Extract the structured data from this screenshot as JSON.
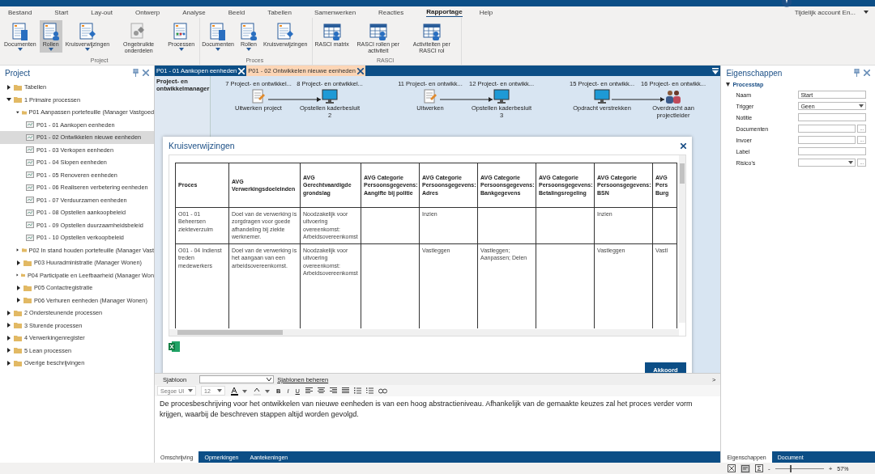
{
  "account": {
    "label": "Tijdelijk account En..."
  },
  "menu": [
    {
      "label": "Bestand",
      "selected": false
    },
    {
      "label": "Start",
      "selected": false
    },
    {
      "label": "Lay-out",
      "selected": false
    },
    {
      "label": "Ontwerp",
      "selected": false
    },
    {
      "label": "Analyse",
      "selected": false
    },
    {
      "label": "Beeld",
      "selected": false
    },
    {
      "label": "Tabellen",
      "selected": false
    },
    {
      "label": "Samenwerken",
      "selected": false
    },
    {
      "label": "Reacties",
      "selected": false
    },
    {
      "label": "Rapportage",
      "selected": true
    },
    {
      "label": "Help",
      "selected": false
    }
  ],
  "ribbon": [
    {
      "label": "Project",
      "buttons": [
        {
          "label": "Documenten",
          "dropdown": true,
          "selected": false
        },
        {
          "label": "Rollen",
          "dropdown": true,
          "selected": true
        },
        {
          "label": "Kruisverwijzingen",
          "dropdown": true,
          "selected": false
        },
        {
          "label": "Ongebruikte onderdelen",
          "dropdown": false,
          "selected": false
        },
        {
          "label": "Processen",
          "dropdown": true,
          "selected": false
        }
      ]
    },
    {
      "label": "Proces",
      "buttons": [
        {
          "label": "Documenten",
          "dropdown": true,
          "selected": false
        },
        {
          "label": "Rollen",
          "dropdown": true,
          "selected": false
        },
        {
          "label": "Kruisverwijzingen",
          "dropdown": false,
          "selected": false
        }
      ]
    },
    {
      "label": "RASCI",
      "buttons": [
        {
          "label": "RASCI matrix",
          "dropdown": false,
          "selected": false
        },
        {
          "label": "RASCI rollen per activiteit",
          "dropdown": false,
          "selected": false
        },
        {
          "label": "Activiteiten per RASCI rol",
          "dropdown": false,
          "selected": false
        }
      ]
    }
  ],
  "project_panel": {
    "title": "Project",
    "tree": [
      {
        "label": "Tabellen",
        "kind": "folder",
        "expanded": false,
        "selected": false
      },
      {
        "label": "1 Primaire processen",
        "kind": "folder",
        "expanded": true,
        "selected": false,
        "children": [
          {
            "label": "P01 Aanpassen portefeuille (Manager Vastgoed",
            "kind": "folder",
            "expanded": true,
            "selected": false,
            "children": [
              {
                "label": "P01 - 01 Aankopen eenheden",
                "kind": "process",
                "selected": false
              },
              {
                "label": "P01 - 02 Ontwikkelen nieuwe eenheden",
                "kind": "process",
                "selected": true
              },
              {
                "label": "P01 - 03 Verkopen eenheden",
                "kind": "process",
                "selected": false
              },
              {
                "label": "P01 - 04 Slopen eenheden",
                "kind": "process",
                "selected": false
              },
              {
                "label": "P01 - 05 Renoveren eenheden",
                "kind": "process",
                "selected": false
              },
              {
                "label": "P01 - 06 Realiseren verbetering eenheden",
                "kind": "process",
                "selected": false
              },
              {
                "label": "P01 - 07 Verduurzamen eenheden",
                "kind": "process",
                "selected": false
              },
              {
                "label": "P01 - 08 Opstellen aankoopbeleid",
                "kind": "process",
                "selected": false
              },
              {
                "label": "P01 - 09 Opstellen duurzaamheidsbeleid",
                "kind": "process",
                "selected": false
              },
              {
                "label": "P01 - 10 Opstellen verkoopbeleid",
                "kind": "process",
                "selected": false
              }
            ]
          },
          {
            "label": "P02 In stand houden portefeuille (Manager Vast",
            "kind": "folder",
            "expanded": false,
            "selected": false
          },
          {
            "label": "P03 Huuradministratie (Manager Wonen)",
            "kind": "folder",
            "expanded": false,
            "selected": false
          },
          {
            "label": "P04 Participatie en Leefbaarheid (Manager Won",
            "kind": "folder",
            "expanded": false,
            "selected": false
          },
          {
            "label": "P05 Contactregistratie",
            "kind": "folder",
            "expanded": false,
            "selected": false
          },
          {
            "label": "P06 Verhuren eenheden (Manager Wonen)",
            "kind": "folder",
            "expanded": false,
            "selected": false
          }
        ]
      },
      {
        "label": "2 Ondersteunende processen",
        "kind": "folder",
        "expanded": false,
        "selected": false
      },
      {
        "label": "3 Sturende processen",
        "kind": "folder",
        "expanded": false,
        "selected": false
      },
      {
        "label": "4 Verwerkingenregister",
        "kind": "folder",
        "expanded": false,
        "selected": false
      },
      {
        "label": "5 Lean processen",
        "kind": "folder",
        "expanded": false,
        "selected": false
      },
      {
        "label": "Overige beschrijvingen",
        "kind": "folder",
        "expanded": false,
        "selected": false
      }
    ]
  },
  "editor_tabs": [
    {
      "label": "P01 - 01 Aankopen eenheden",
      "selected": false
    },
    {
      "label": "P01 - 02 Ontwikkelen nieuwe eenheden",
      "selected": true
    }
  ],
  "diagram": {
    "lane": "Project- en ontwikkelmanager",
    "steps": [
      {
        "number": "7 Project- en ontwikkel...",
        "label": "Uitwerken project",
        "kind": "manual"
      },
      {
        "number": "8 Project- en ontwikkel...",
        "label": "Opstellen kaderbesluit 2",
        "kind": "system"
      },
      {
        "number": "11 Project- en ontwikk...",
        "label": "Uitwerken",
        "kind": "manual"
      },
      {
        "number": "12 Project- en ontwikk...",
        "label": "Opstellen kaderbesluit 3",
        "kind": "system"
      },
      {
        "number": "15 Project- en ontwikk...",
        "label": "Opdracht verstrekken",
        "kind": "system"
      },
      {
        "number": "16 Project- en ontwikk...",
        "label": "Overdracht aan projectleider",
        "kind": "handover"
      }
    ]
  },
  "dialog": {
    "title": "Kruisverwijzingen",
    "columns": [
      "Proces",
      "AVG Verwerkingsdoeleinden",
      "AVG Gerechtvaardigde grondslag",
      "AVG Categorie Persoonsgegevens: Aangifte bij politie",
      "AVG Categorie Persoonsgegevens: Adres",
      "AVG Categorie Persoonsgegevens: Bankgegevens",
      "AVG Categorie Persoonsgegevens: Betalingsregeling",
      "AVG Categorie Persoonsgegevens: BSN",
      "AVG Pers Burg"
    ],
    "rows": [
      [
        "O01 - 01 Beheersen ziekteverzuim",
        "Doel van de verwerking is zorgdragen voor goede afhandeling bij ziekte werknemer.",
        "Noodzakelijk voor uitvoering overeenkomst: Arbeidsovereenkomst",
        "",
        "Inzien",
        "",
        "",
        "Inzien",
        ""
      ],
      [
        "O01 - 04 Indienst treden medewerkers",
        "Doel van de verwerking is het aangaan van een arbeidsovereenkomst.",
        "Noodzakelijk voor uitvoering overeenkomst: Arbeidsovereenkomst",
        "",
        "Vastleggen",
        "Vastleggen; Aanpassen; Delen",
        "",
        "Vastleggen",
        "Vastl"
      ]
    ],
    "button": "Akkoord"
  },
  "editor": {
    "template_label": "Sjabloon",
    "template_link": "Sjablonen beheren",
    "expand": ">",
    "font": "Segoe UI",
    "size": "12",
    "format": [
      "B",
      "I",
      "U"
    ],
    "text": "De procesbeschrijving voor het ontwikkelen van nieuwe eenheden is van een hoog abstractieniveau. Afhankelijk van de gemaakte keuzes zal het proces verder vorm krijgen, waarbij de beschreven stappen altijd worden gevolgd."
  },
  "bottom_tabs": [
    {
      "label": "Omschrijving",
      "selected": true
    },
    {
      "label": "Opmerkingen",
      "selected": false
    },
    {
      "label": "Aantekeningen",
      "selected": false
    }
  ],
  "properties": {
    "title": "Eigenschappen",
    "section": "Processtap",
    "fields": [
      {
        "label": "Naam",
        "kind": "text",
        "value": "Start"
      },
      {
        "label": "Trigger",
        "kind": "select",
        "value": "Geen"
      },
      {
        "label": "Notitie",
        "kind": "text"
      },
      {
        "label": "Documenten",
        "kind": "browse",
        "button": "..."
      },
      {
        "label": "Invoer",
        "kind": "browse",
        "button": "..."
      },
      {
        "label": "Label",
        "kind": "text"
      },
      {
        "label": "Risico's",
        "kind": "select-browse",
        "button": "..."
      }
    ]
  },
  "side_tabs": [
    {
      "label": "Eigenschappen",
      "selected": true
    },
    {
      "label": "Document",
      "selected": false
    }
  ],
  "status": {
    "minus": "-",
    "plus": "+",
    "zoom": "57%",
    "level": 0.3
  }
}
